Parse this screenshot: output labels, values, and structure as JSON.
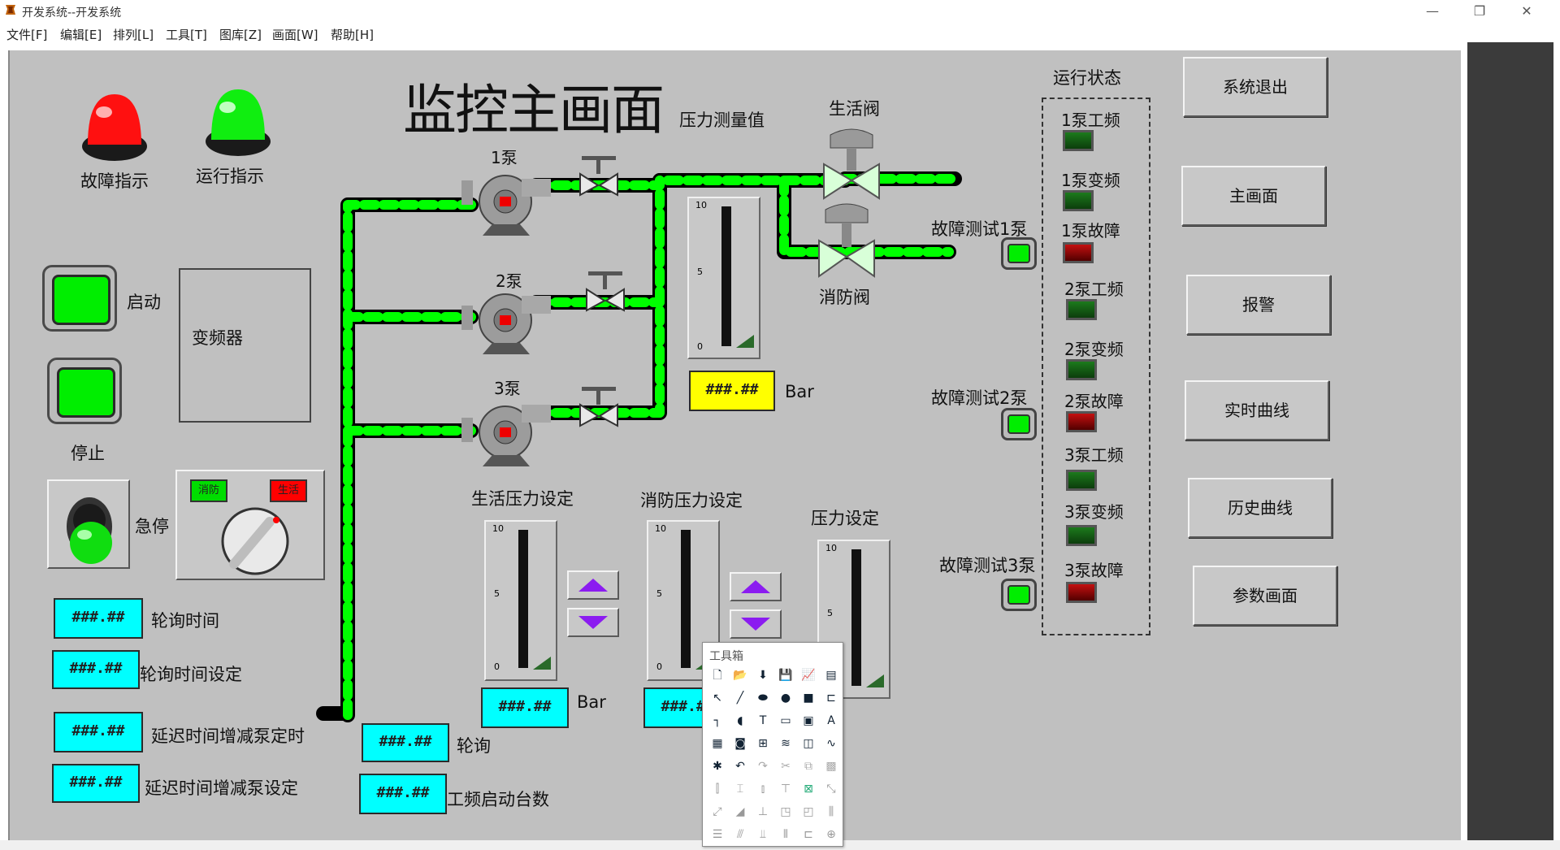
{
  "window": {
    "title": "开发系统--开发系统",
    "controls": {
      "minimize": "—",
      "restore": "❐",
      "close": "✕"
    }
  },
  "menu": [
    "文件[F]",
    "编辑[E]",
    "排列[L]",
    "工具[T]",
    "图库[Z]",
    "画面[W]",
    "帮助[H]"
  ],
  "screen": {
    "title": "监控主画面",
    "fault_indicator": "故障指示",
    "run_indicator": "运行指示",
    "start": "启动",
    "stop": "停止",
    "estop": "急停",
    "inverter": "变频器",
    "mode_fire": "消防",
    "mode_life": "生活",
    "pump1": "1泵",
    "pump2": "2泵",
    "pump3": "3泵",
    "pressure_measure": "压力测量值",
    "life_valve": "生活阀",
    "fire_valve": "消防阀",
    "pressure_value": "###.##",
    "bar": "Bar",
    "life_pressure_set": "生活压力设定",
    "fire_pressure_set": "消防压力设定",
    "pressure_set": "压力设定",
    "poll_time": "轮询时间",
    "poll_time_set": "轮询时间设定",
    "delay_add_pump_time": "延迟时间增减泵定时",
    "delay_add_pump_set": "延迟时间增减泵设定",
    "poll": "轮询",
    "freq_start_count": "工频启动台数",
    "placeholder": "###.##",
    "fault_test_1": "故障测试1泵",
    "fault_test_2": "故障测试2泵",
    "fault_test_3": "故障测试3泵"
  },
  "gauge_scale": {
    "max": "10",
    "mid": "5",
    "min": "0"
  },
  "status": {
    "title": "运行状态",
    "items": [
      {
        "label": "1泵工频",
        "state": "green"
      },
      {
        "label": "1泵变频",
        "state": "green"
      },
      {
        "label": "1泵故障",
        "state": "red"
      },
      {
        "label": "2泵工频",
        "state": "green"
      },
      {
        "label": "2泵变频",
        "state": "green"
      },
      {
        "label": "2泵故障",
        "state": "red"
      },
      {
        "label": "3泵工频",
        "state": "green"
      },
      {
        "label": "3泵变频",
        "state": "green"
      },
      {
        "label": "3泵故障",
        "state": "red"
      }
    ]
  },
  "nav": {
    "exit": "系统退出",
    "main": "主画面",
    "alarm": "报警",
    "realtime": "实时曲线",
    "history": "历史曲线",
    "params": "参数画面"
  },
  "toolbox": {
    "title": "工具箱"
  },
  "colors": {
    "canvas": "#c0c0c0",
    "pipe": "#00ff00",
    "display": "#00ffff",
    "display_pressure": "#ffff00",
    "arrow": "#8b1cf0"
  }
}
